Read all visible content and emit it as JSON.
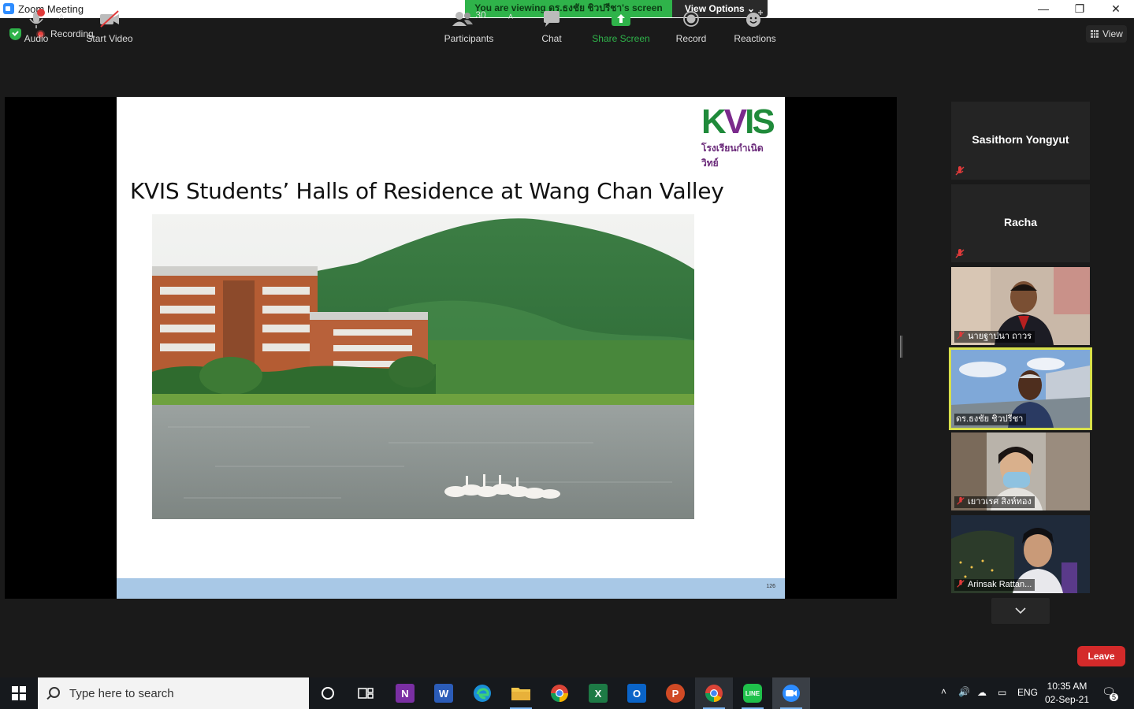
{
  "window": {
    "title": "Zoom Meeting",
    "minimize": "—",
    "restore": "❐",
    "close": "✕"
  },
  "banner": {
    "viewing_text": "You are viewing ดร.ธงชัย ชิวปรีชา's screen",
    "view_options_label": "View Options ⌄"
  },
  "infobar": {
    "recording_label": "Recording",
    "view_label": "View"
  },
  "slide": {
    "logo_text": "KVIS",
    "logo_thai": "โรงเรียนกำเนิดวิทย์",
    "title": "KVIS Students’ Halls of Residence at Wang Chan Valley",
    "page_number": "126"
  },
  "participants": [
    {
      "name": "Sasithorn Yongyut",
      "muted": true,
      "video": false
    },
    {
      "name": "Racha",
      "muted": true,
      "video": false
    },
    {
      "name": "นายฐาปนา ถาวร",
      "muted": true,
      "video": true
    },
    {
      "name": "ดร.ธงชัย ชิวปรีชา",
      "muted": false,
      "video": true,
      "active_speaker": true
    },
    {
      "name": "เยาวเรศ สิงห์ทอง",
      "muted": true,
      "video": true
    },
    {
      "name": "Arinsak Rattan...",
      "muted": true,
      "video": true
    }
  ],
  "toolbar": {
    "audio": "Audio",
    "start_video": "Start Video",
    "participants": "Participants",
    "participants_count": "30",
    "chat": "Chat",
    "share_screen": "Share Screen",
    "record": "Record",
    "reactions": "Reactions",
    "leave": "Leave",
    "audio_alert": "!"
  },
  "taskbar": {
    "search_placeholder": "Type here to search",
    "language": "ENG",
    "time": "10:35 AM",
    "date": "02-Sep-21",
    "notifications": "5"
  },
  "colors": {
    "banner_green": "#2fb34a",
    "leave_red": "#d42a2a",
    "share_green": "#2fb34a",
    "active_speaker": "#d8e04a"
  }
}
